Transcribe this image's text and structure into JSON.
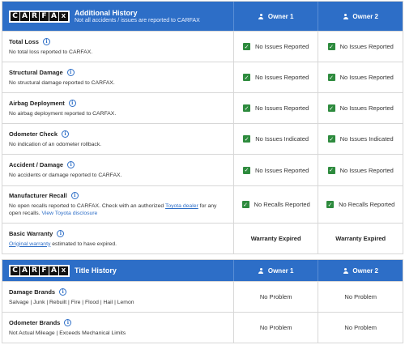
{
  "additional_history": {
    "logo_letters": [
      "C",
      "A",
      "R",
      "F",
      "A",
      "X"
    ],
    "title": "Additional History",
    "subtitle": "Not all accidents / issues are reported to CARFAX",
    "owner1": "Owner 1",
    "owner2": "Owner 2",
    "rows": [
      {
        "title": "Total Loss",
        "sub": "No total loss reported to CARFAX.",
        "o1": "No Issues Reported",
        "o2": "No Issues Reported"
      },
      {
        "title": "Structural Damage",
        "sub": "No structural damage reported to CARFAX.",
        "o1": "No Issues Reported",
        "o2": "No Issues Reported"
      },
      {
        "title": "Airbag Deployment",
        "sub": "No airbag deployment reported to CARFAX.",
        "o1": "No Issues Reported",
        "o2": "No Issues Reported"
      },
      {
        "title": "Odometer Check",
        "sub": "No indication of an odometer rollback.",
        "o1": "No Issues Indicated",
        "o2": "No Issues Indicated"
      },
      {
        "title": "Accident / Damage",
        "sub": "No accidents or damage reported to CARFAX.",
        "o1": "No Issues Reported",
        "o2": "No Issues Reported"
      }
    ],
    "recall": {
      "title": "Manufacturer Recall",
      "sub_before": "No open recalls reported to CARFAX. Check with an authorized ",
      "sub_link": "Toyota dealer",
      "sub_after": " for any open recalls. ",
      "sub_link2": "View Toyota disclosure",
      "o1": "No Recalls Reported",
      "o2": "No Recalls Reported"
    },
    "warranty": {
      "title": "Basic Warranty",
      "sub_link": "Original warranty",
      "sub_after": " estimated to have expired.",
      "o1": "Warranty Expired",
      "o2": "Warranty Expired"
    }
  },
  "title_history": {
    "title": "Title History",
    "owner1": "Owner 1",
    "owner2": "Owner 2",
    "rows": [
      {
        "title": "Damage Brands",
        "sub": "Salvage | Junk | Rebuilt | Fire | Flood | Hail | Lemon",
        "o1": "No Problem",
        "o2": "No Problem"
      },
      {
        "title": "Odometer Brands",
        "sub": "Not Actual Mileage | Exceeds Mechanical Limits",
        "o1": "No Problem",
        "o2": "No Problem"
      }
    ]
  },
  "colors": {
    "header_blue": "#2d6ec7",
    "check_green": "#2e8b3e"
  },
  "icons": {
    "info": "info-icon",
    "check": "check-icon",
    "owner": "person-icon"
  }
}
